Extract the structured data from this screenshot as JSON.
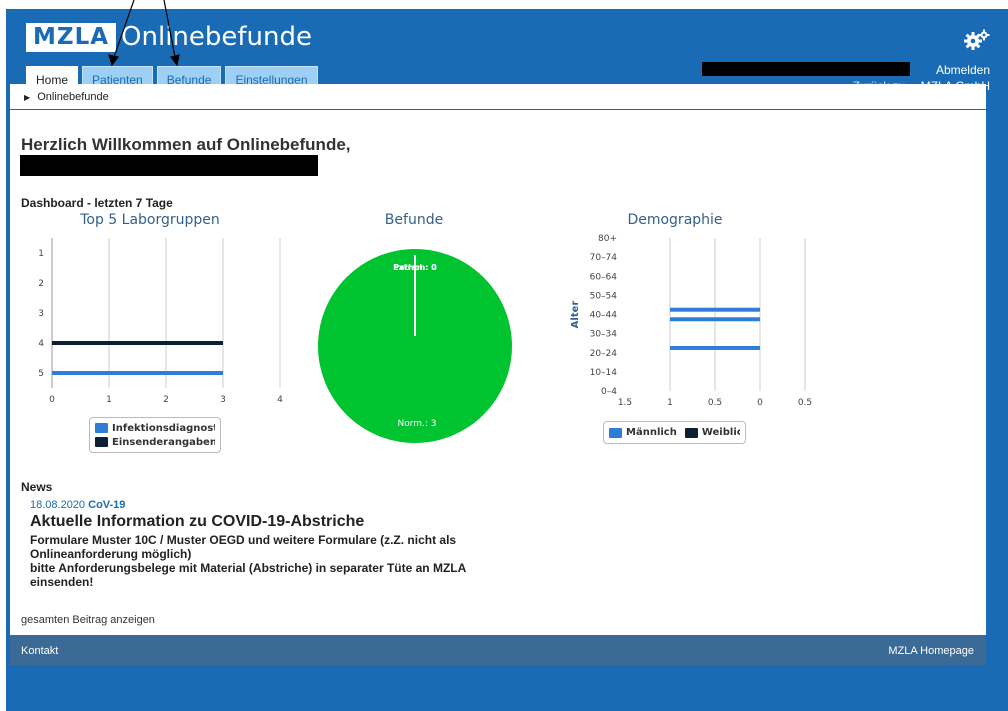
{
  "header": {
    "logo": "MZLA",
    "app_title": "Onlinebefunde",
    "logout": "Abmelden",
    "back_label": "Zurück zu",
    "back_target": "MZLA GmbH"
  },
  "tabs": [
    {
      "label": "Home",
      "active": true
    },
    {
      "label": "Patienten",
      "active": false
    },
    {
      "label": "Befunde",
      "active": false
    },
    {
      "label": "Einstellungen",
      "active": false
    }
  ],
  "breadcrumb": "Onlinebefunde",
  "welcome": "Herzlich Willkommen auf Onlinebefunde,",
  "dashboard_title": "Dashboard - letzten 7 Tage",
  "colors": {
    "header_blue": "#1a6bb5",
    "series_blue": "#2e7dd7",
    "series_dark": "#0d1f33",
    "pie_green": "#00c330",
    "footer": "#3a6a95"
  },
  "chart_data": [
    {
      "type": "bar",
      "orientation": "horizontal",
      "title": "Top 5 Laborgruppen",
      "categories": [
        "1",
        "2",
        "3",
        "4",
        "5"
      ],
      "xlim": [
        0,
        4
      ],
      "x_ticks": [
        "0",
        "1",
        "2",
        "3",
        "4"
      ],
      "series": [
        {
          "name": "Infektionsdiagnostik",
          "values": [
            0,
            0,
            0,
            0,
            3
          ],
          "color": "#2e7dd7"
        },
        {
          "name": "Einsenderangaben:",
          "values": [
            0,
            0,
            0,
            3,
            0
          ],
          "color": "#0d1f33"
        }
      ],
      "grid": true,
      "legend": "bottom"
    },
    {
      "type": "pie",
      "title": "Befunde",
      "slices": [
        {
          "label": "Norm.: 3",
          "value": 3,
          "color": "#00c330"
        },
        {
          "label": "Pathol.: 0",
          "value": 0,
          "color": "#00c330"
        },
        {
          "label": "Extrem: 0",
          "value": 0,
          "color": "#00c330"
        }
      ]
    },
    {
      "type": "bar",
      "orientation": "horizontal",
      "title": "Demographie",
      "ylabel": "Alter",
      "categories": [
        "0–4",
        "10–14",
        "20–24",
        "30–34",
        "40–44",
        "50–54",
        "60–64",
        "70–74",
        "80+"
      ],
      "x_ticks": [
        "1.5",
        "1",
        "0.5",
        "0",
        "0.5"
      ],
      "series": [
        {
          "name": "Männlich",
          "bars": [
            {
              "category": "20–24",
              "value": 1
            },
            {
              "category": "35–39",
              "value": 1
            },
            {
              "category": "40–44",
              "value": 1
            }
          ],
          "color": "#2e7dd7"
        },
        {
          "name": "Weiblich",
          "bars": [],
          "color": "#0d1f33"
        }
      ],
      "grid": true,
      "legend": "bottom"
    }
  ],
  "news": {
    "heading": "News",
    "date": "18.08.2020",
    "tag": "CoV-19",
    "title": "Aktuelle Information zu COVID-19-Abstriche",
    "lines": [
      "Formulare Muster 10C / Muster OEGD und weitere Formulare (z.Z. nicht als",
      "Onlineanforderung möglich)",
      "bitte Anforderungsbelege mit Material (Abstriche) in separater Tüte an MZLA einsenden!"
    ],
    "read_more": "gesamten Beitrag anzeigen"
  },
  "footer": {
    "left": "Kontakt",
    "right": "MZLA Homepage"
  }
}
